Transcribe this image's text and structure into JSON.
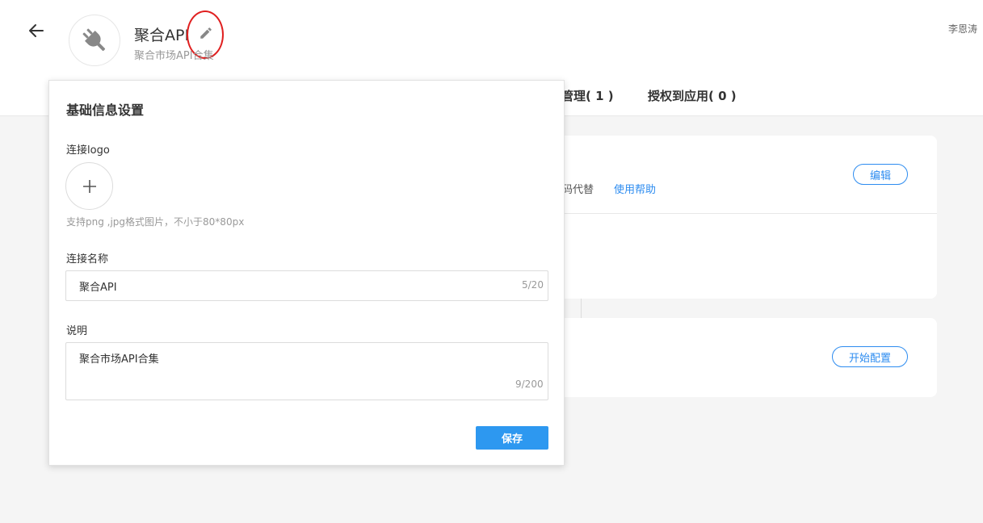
{
  "header": {
    "title": "聚合API",
    "subtitle": "聚合市场API合集",
    "user": "李恩涛"
  },
  "tabs": [
    {
      "label": "管理( 1 )"
    },
    {
      "label": "授权到应用( 0 )"
    }
  ],
  "card1": {
    "edit_label": "编辑",
    "hint": "掩码代替",
    "help_link": "使用帮助"
  },
  "card2": {
    "start_label": "开始配置"
  },
  "panel": {
    "title": "基础信息设置",
    "logo_label": "连接logo",
    "upload_hint": "支持png ,jpg格式图片，不小于80*80px",
    "name_label": "连接名称",
    "name_value": "聚合API",
    "name_count": "5/20",
    "desc_label": "说明",
    "desc_value": "聚合市场API合集",
    "desc_count": "9/200",
    "save_label": "保存"
  },
  "icons": {
    "back": "arrow-left-icon",
    "logo": "plug-icon",
    "edit": "pencil-icon",
    "upload": "plus-icon"
  },
  "colors": {
    "accent": "#2d8cf0",
    "primary_button": "#2d98f0",
    "annotation": "#e02020"
  }
}
